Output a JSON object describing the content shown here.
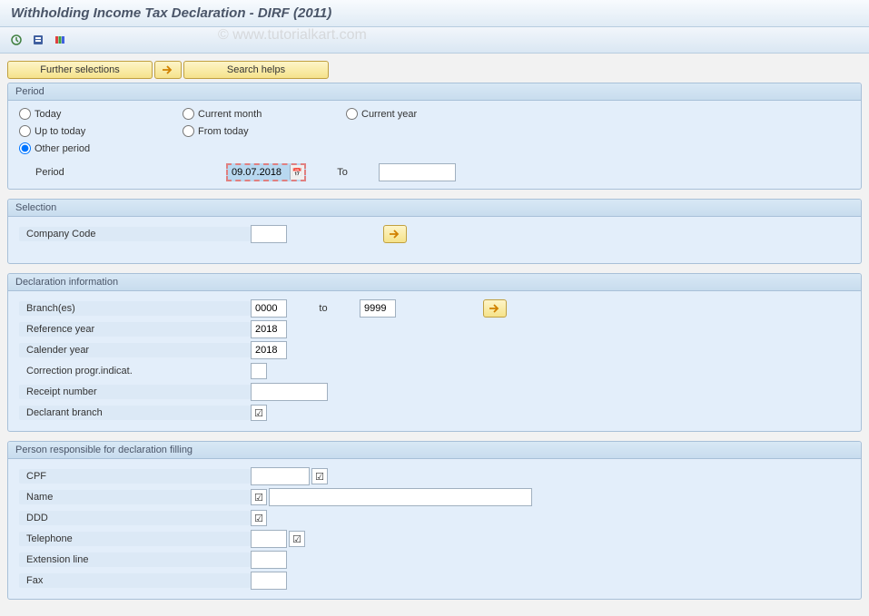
{
  "title": "Withholding Income Tax Declaration - DIRF (2011)",
  "watermark": "© www.tutorialkart.com",
  "buttons": {
    "further_selections": "Further selections",
    "search_helps": "Search helps"
  },
  "period": {
    "header": "Period",
    "options": {
      "today": "Today",
      "current_month": "Current month",
      "current_year": "Current year",
      "up_to_today": "Up to today",
      "from_today": "From today",
      "other_period": "Other period"
    },
    "period_label": "Period",
    "period_from": "09.07.2018",
    "to_label": "To",
    "period_to": ""
  },
  "selection": {
    "header": "Selection",
    "company_code_label": "Company Code",
    "company_code_value": ""
  },
  "declaration": {
    "header": "Declaration information",
    "branches_label": "Branch(es)",
    "branches_from": "0000",
    "branches_to_label": "to",
    "branches_to": "9999",
    "ref_year_label": "Reference year",
    "ref_year_value": "2018",
    "cal_year_label": "Calender year",
    "cal_year_value": "2018",
    "correction_label": "Correction progr.indicat.",
    "receipt_label": "Receipt number",
    "receipt_value": "",
    "declarant_label": "Declarant branch",
    "declarant_checked": "☑"
  },
  "responsible": {
    "header": "Person responsible for declaration filling",
    "cpf_label": "CPF",
    "cpf_value": "",
    "cpf_checked": "☑",
    "name_label": "Name",
    "name_value": "",
    "name_checked": "☑",
    "ddd_label": "DDD",
    "ddd_value": "",
    "ddd_checked": "☑",
    "telephone_label": "Telephone",
    "telephone_value": "",
    "telephone_checked": "☑",
    "ext_label": "Extension line",
    "ext_value": "",
    "fax_label": "Fax",
    "fax_value": ""
  }
}
